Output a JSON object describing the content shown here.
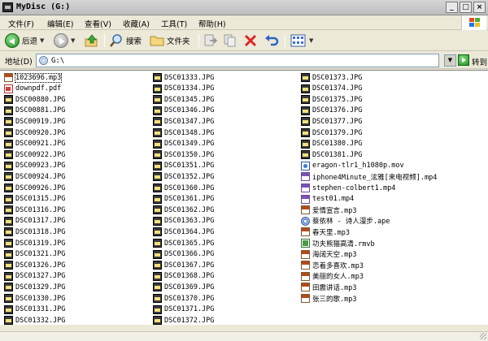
{
  "window": {
    "title": "MyDisc (G:)"
  },
  "menu": [
    "文件(F)",
    "编辑(E)",
    "查看(V)",
    "收藏(A)",
    "工具(T)",
    "帮助(H)"
  ],
  "toolbar": {
    "back_label": "后退",
    "search_label": "搜索",
    "folders_label": "文件夹"
  },
  "address": {
    "label": "地址(D)",
    "value": "G:\\",
    "go_label": "转到"
  },
  "files": {
    "col1": [
      {
        "name": "1023696.mp3",
        "type": "mp3",
        "selected": true
      },
      {
        "name": "downpdf.pdf",
        "type": "pdf"
      },
      {
        "name": "DSC00880.JPG",
        "type": "jpg"
      },
      {
        "name": "DSC00881.JPG",
        "type": "jpg"
      },
      {
        "name": "DSC00919.JPG",
        "type": "jpg"
      },
      {
        "name": "DSC00920.JPG",
        "type": "jpg"
      },
      {
        "name": "DSC00921.JPG",
        "type": "jpg"
      },
      {
        "name": "DSC00922.JPG",
        "type": "jpg"
      },
      {
        "name": "DSC00923.JPG",
        "type": "jpg"
      },
      {
        "name": "DSC00924.JPG",
        "type": "jpg"
      },
      {
        "name": "DSC00926.JPG",
        "type": "jpg"
      },
      {
        "name": "DSC01315.JPG",
        "type": "jpg"
      },
      {
        "name": "DSC01316.JPG",
        "type": "jpg"
      },
      {
        "name": "DSC01317.JPG",
        "type": "jpg"
      },
      {
        "name": "DSC01318.JPG",
        "type": "jpg"
      },
      {
        "name": "DSC01319.JPG",
        "type": "jpg"
      },
      {
        "name": "DSC01321.JPG",
        "type": "jpg"
      },
      {
        "name": "DSC01326.JPG",
        "type": "jpg"
      },
      {
        "name": "DSC01327.JPG",
        "type": "jpg"
      },
      {
        "name": "DSC01329.JPG",
        "type": "jpg"
      },
      {
        "name": "DSC01330.JPG",
        "type": "jpg"
      },
      {
        "name": "DSC01331.JPG",
        "type": "jpg"
      },
      {
        "name": "DSC01332.JPG",
        "type": "jpg"
      }
    ],
    "col2": [
      {
        "name": "DSC01333.JPG",
        "type": "jpg"
      },
      {
        "name": "DSC01334.JPG",
        "type": "jpg"
      },
      {
        "name": "DSC01345.JPG",
        "type": "jpg"
      },
      {
        "name": "DSC01346.JPG",
        "type": "jpg"
      },
      {
        "name": "DSC01347.JPG",
        "type": "jpg"
      },
      {
        "name": "DSC01348.JPG",
        "type": "jpg"
      },
      {
        "name": "DSC01349.JPG",
        "type": "jpg"
      },
      {
        "name": "DSC01350.JPG",
        "type": "jpg"
      },
      {
        "name": "DSC01351.JPG",
        "type": "jpg"
      },
      {
        "name": "DSC01352.JPG",
        "type": "jpg"
      },
      {
        "name": "DSC01360.JPG",
        "type": "jpg"
      },
      {
        "name": "DSC01361.JPG",
        "type": "jpg"
      },
      {
        "name": "DSC01362.JPG",
        "type": "jpg"
      },
      {
        "name": "DSC01363.JPG",
        "type": "jpg"
      },
      {
        "name": "DSC01364.JPG",
        "type": "jpg"
      },
      {
        "name": "DSC01365.JPG",
        "type": "jpg"
      },
      {
        "name": "DSC01366.JPG",
        "type": "jpg"
      },
      {
        "name": "DSC01367.JPG",
        "type": "jpg"
      },
      {
        "name": "DSC01368.JPG",
        "type": "jpg"
      },
      {
        "name": "DSC01369.JPG",
        "type": "jpg"
      },
      {
        "name": "DSC01370.JPG",
        "type": "jpg"
      },
      {
        "name": "DSC01371.JPG",
        "type": "jpg"
      },
      {
        "name": "DSC01372.JPG",
        "type": "jpg"
      }
    ],
    "col3": [
      {
        "name": "DSC01373.JPG",
        "type": "jpg"
      },
      {
        "name": "DSC01374.JPG",
        "type": "jpg"
      },
      {
        "name": "DSC01375.JPG",
        "type": "jpg"
      },
      {
        "name": "DSC01376.JPG",
        "type": "jpg"
      },
      {
        "name": "DSC01377.JPG",
        "type": "jpg"
      },
      {
        "name": "DSC01379.JPG",
        "type": "jpg"
      },
      {
        "name": "DSC01380.JPG",
        "type": "jpg"
      },
      {
        "name": "DSC01381.JPG",
        "type": "jpg"
      },
      {
        "name": "eragon-tlr1_h1080p.mov",
        "type": "mov"
      },
      {
        "name": "iphone4Minute_泫雅[来电视频].mp4",
        "type": "mp4"
      },
      {
        "name": "stephen-colbert1.mp4",
        "type": "mp4"
      },
      {
        "name": "test01.mp4",
        "type": "mp4"
      },
      {
        "name": "爱情宣言.mp3",
        "type": "mp3"
      },
      {
        "name": "蔡依林 - 诗人漫步.ape",
        "type": "ape"
      },
      {
        "name": "春天里.mp3",
        "type": "mp3"
      },
      {
        "name": "功夫熊猫高清.rmvb",
        "type": "rmvb"
      },
      {
        "name": "海阔天空.mp3",
        "type": "mp3"
      },
      {
        "name": "恋着多喜欢.mp3",
        "type": "mp3"
      },
      {
        "name": "美丽的女人.mp3",
        "type": "mp3"
      },
      {
        "name": "田震讲话.mp3",
        "type": "mp3"
      },
      {
        "name": "张三的歌.mp3",
        "type": "mp3"
      }
    ]
  }
}
